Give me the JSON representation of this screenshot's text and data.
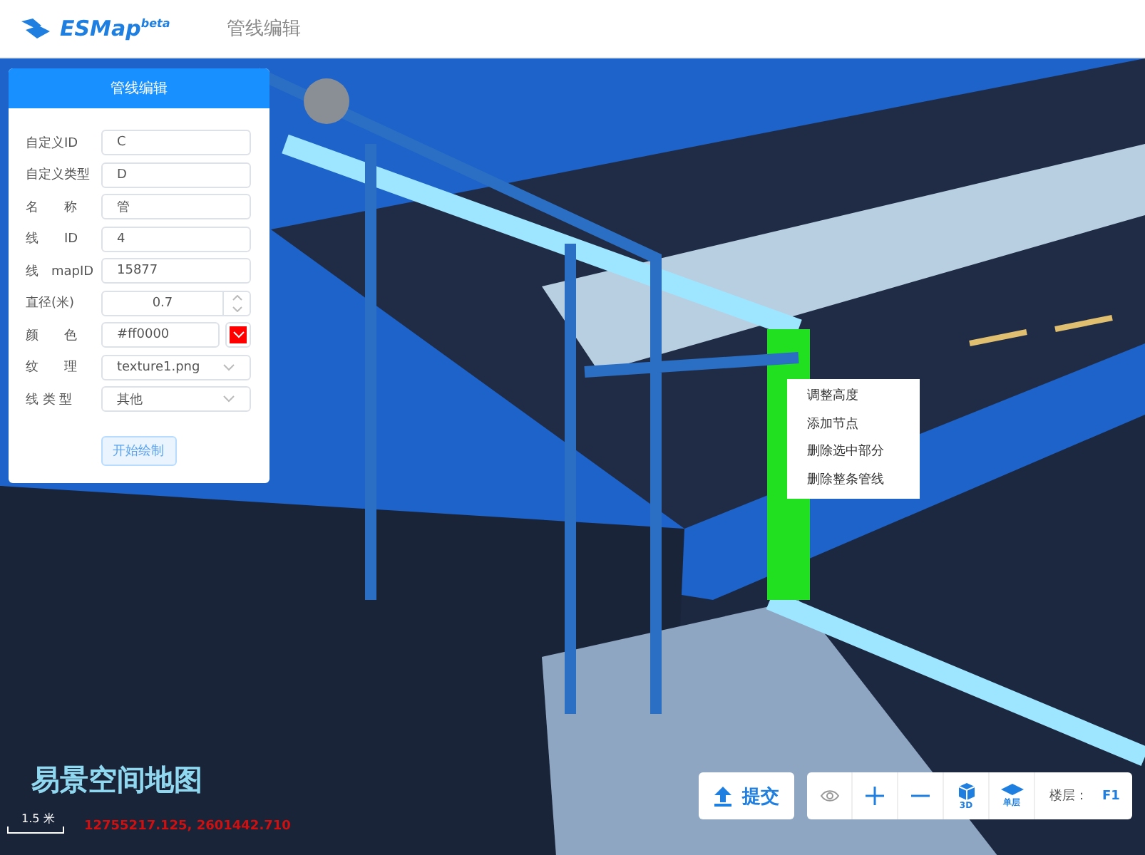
{
  "header": {
    "logo": "ESMap",
    "logo_sup": "beta",
    "nav": "管线编辑"
  },
  "panel": {
    "title": "管线编辑",
    "fields": [
      {
        "kind": "text",
        "label": "自定义ID",
        "value": "C"
      },
      {
        "kind": "text",
        "label": "自定义类型",
        "value": "D"
      },
      {
        "kind": "text",
        "label": "名　　称",
        "value": "管"
      },
      {
        "kind": "text",
        "label": "线　　ID",
        "value": "4"
      },
      {
        "kind": "text",
        "label": "线　mapID",
        "value": "15877"
      },
      {
        "kind": "number",
        "label": "直径(米)",
        "value": "0.7"
      },
      {
        "kind": "color",
        "label": "颜　　色",
        "value": "#ff0000",
        "color": "#ff0000"
      },
      {
        "kind": "select",
        "label": "纹　　理",
        "value": "texture1.png"
      },
      {
        "kind": "select",
        "label": "线 类 型",
        "value": "其他"
      }
    ],
    "button": "开始绘制"
  },
  "context_menu": [
    "调整高度",
    "添加节点",
    "删除选中部分",
    "删除整条管线"
  ],
  "brand": "易景空间地图",
  "scale": "1.5 米",
  "coordinates": "12755217.125, 2601442.710",
  "submit": "提交",
  "toolbar": {
    "three_d": "3D",
    "floor_mode": "单层",
    "floor_label": "楼层：",
    "floor": "F1"
  }
}
